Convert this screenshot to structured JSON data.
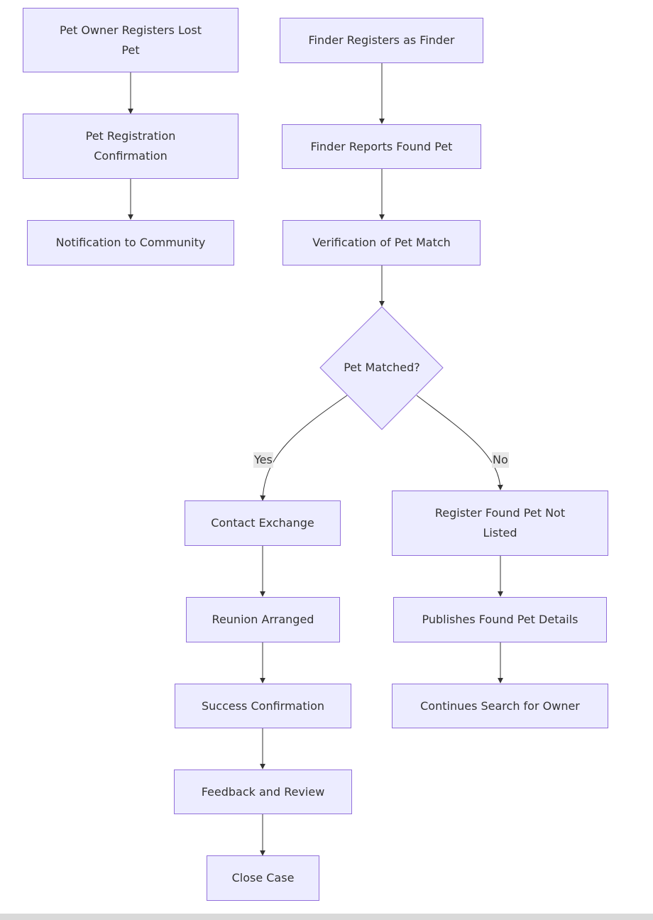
{
  "diagram": {
    "type": "flowchart",
    "colors": {
      "node_fill": "#ececff",
      "node_border": "#9370db",
      "edge": "#333333",
      "label_bg": "#e8e8e8",
      "text": "#333333"
    },
    "nodes": {
      "owner_registers": "Pet Owner Registers Lost Pet",
      "registration_confirm": "Pet Registration Confirmation",
      "notify_community": "Notification to Community",
      "finder_registers": "Finder Registers as Finder",
      "finder_reports": "Finder Reports Found Pet",
      "verification": "Verification of Pet Match",
      "pet_matched": "Pet Matched?",
      "contact_exchange": "Contact Exchange",
      "reunion": "Reunion Arranged",
      "success": "Success Confirmation",
      "feedback": "Feedback and Review",
      "close_case": "Close Case",
      "register_not_listed": "Register Found Pet Not Listed",
      "publishes_details": "Publishes Found Pet Details",
      "continues_search": "Continues Search for Owner"
    },
    "edge_labels": {
      "yes": "Yes",
      "no": "No"
    },
    "edges": [
      [
        "owner_registers",
        "registration_confirm"
      ],
      [
        "registration_confirm",
        "notify_community"
      ],
      [
        "finder_registers",
        "finder_reports"
      ],
      [
        "finder_reports",
        "verification"
      ],
      [
        "verification",
        "pet_matched"
      ],
      [
        "pet_matched",
        "contact_exchange",
        "Yes"
      ],
      [
        "pet_matched",
        "register_not_listed",
        "No"
      ],
      [
        "contact_exchange",
        "reunion"
      ],
      [
        "reunion",
        "success"
      ],
      [
        "success",
        "feedback"
      ],
      [
        "feedback",
        "close_case"
      ],
      [
        "register_not_listed",
        "publishes_details"
      ],
      [
        "publishes_details",
        "continues_search"
      ]
    ]
  }
}
